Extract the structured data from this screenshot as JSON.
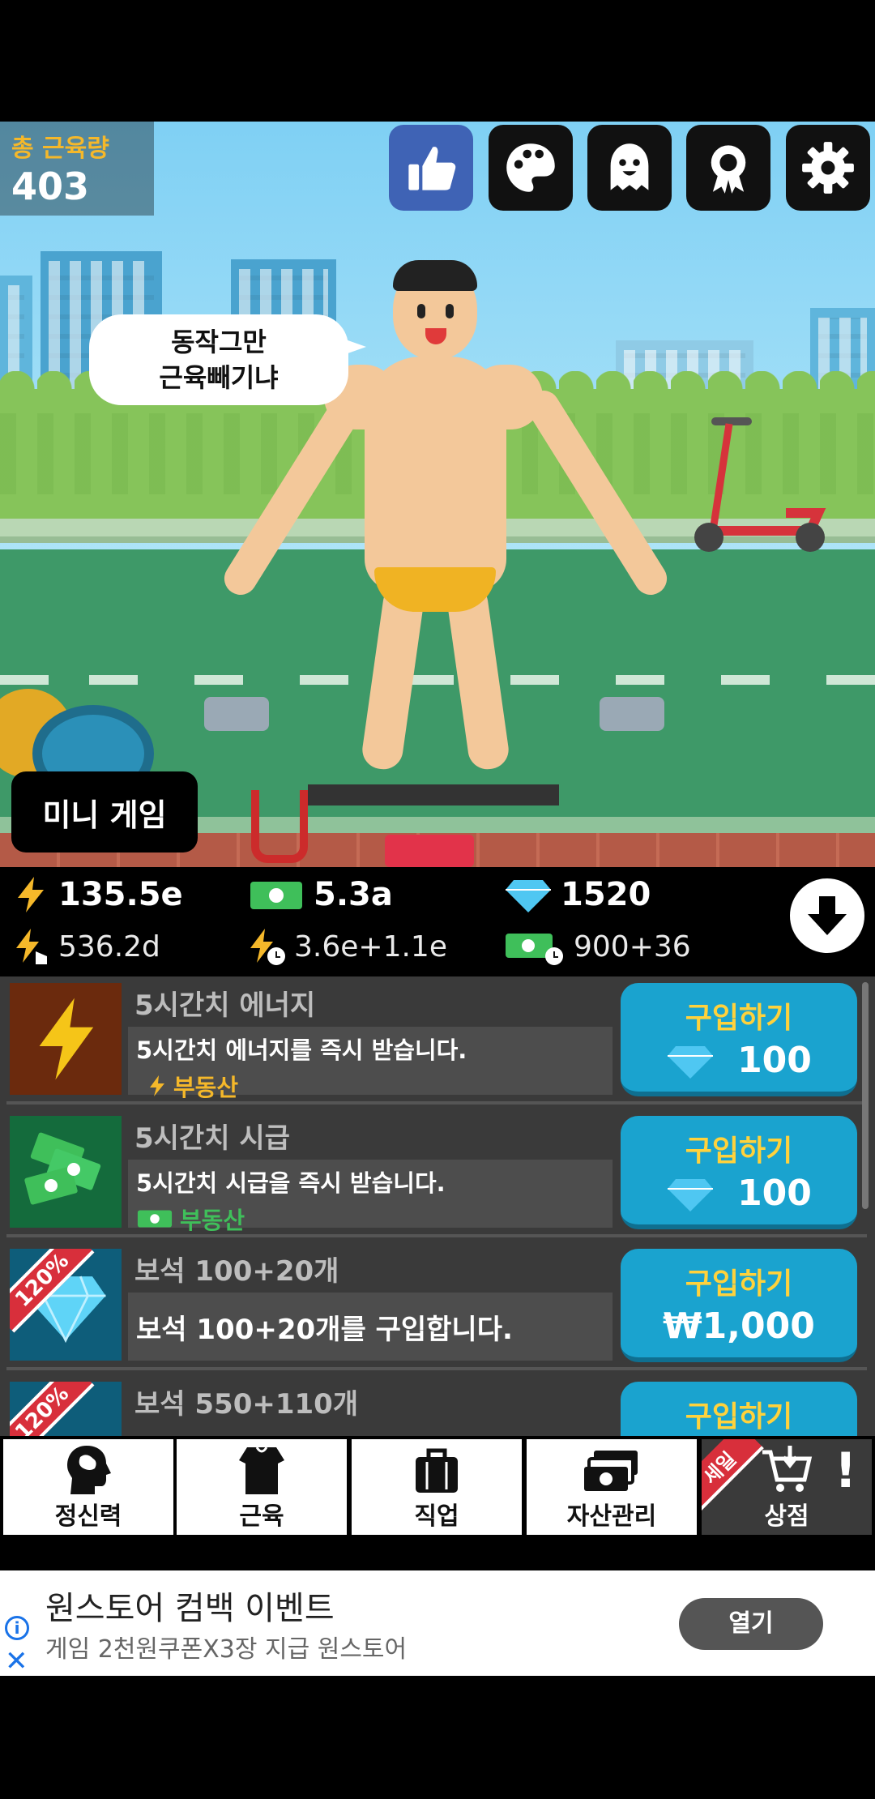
{
  "hud": {
    "muscle_label": "총 근육량",
    "muscle_value": "403",
    "buttons": [
      "thumbs-up-icon",
      "palette-icon",
      "ghost-icon",
      "badge-icon",
      "gear-icon"
    ]
  },
  "character": {
    "speech": [
      "동작그만",
      "근육빼기냐"
    ]
  },
  "mini_game_label": "미니 게임",
  "stats": {
    "energy": "135.5e",
    "cash": "5.3a",
    "gems": "1520",
    "energy_tap": "536.2d",
    "energy_rate": "3.6e+1.1e",
    "cash_rate": "900+36"
  },
  "shop_items": [
    {
      "title": "5시간치 에너지",
      "desc": "5시간치 에너지를 즉시 받습니다.",
      "tag": "부동산",
      "buy_label": "구입하기",
      "price": "100"
    },
    {
      "title": "5시간치 시급",
      "desc": "5시간치 시급을 즉시 받습니다.",
      "tag": "부동산",
      "buy_label": "구입하기",
      "price": "100"
    },
    {
      "title": "보석 100+20개",
      "desc": "보석 100+20개를 구입합니다.",
      "badge": "120%",
      "buy_label": "구입하기",
      "price": "₩1,000"
    },
    {
      "title": "보석 550+110개",
      "badge": "120%",
      "buy_label": "구입하기"
    }
  ],
  "nav": {
    "tabs": [
      "정신력",
      "근육",
      "직업",
      "자산관리",
      "상점"
    ],
    "sale_badge": "세일",
    "alert": "!"
  },
  "ad": {
    "title": "원스토어 컴백 이벤트",
    "subtitle": "게임 2천원쿠폰X3장 지급 원스토어",
    "open_label": "열기"
  },
  "colors": {
    "accent_blue": "#1aa3cf",
    "gold": "#ffd23c",
    "energy_yellow": "#f5b82a",
    "cash_green": "#3fbf5a",
    "sale_red": "#d82f3b"
  }
}
